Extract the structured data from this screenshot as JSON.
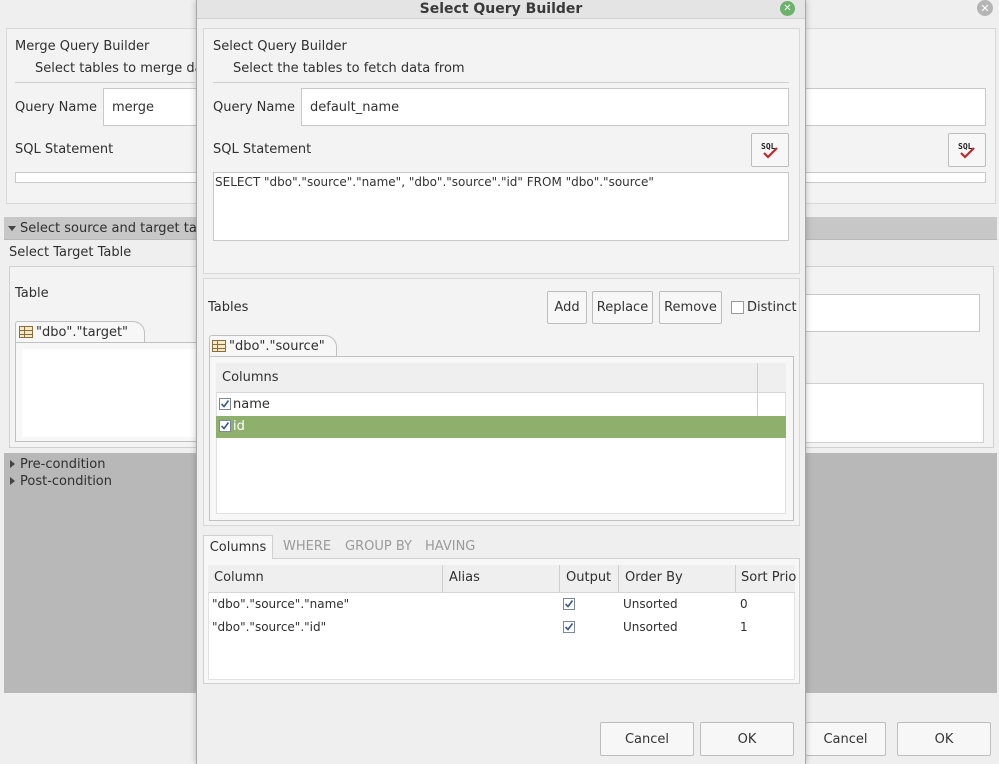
{
  "background": {
    "header_title": "Merge Query Builder",
    "header_subtitle": "Select tables to merge data",
    "query_name_label": "Query Name",
    "query_name_value": "merge",
    "sql_label": "SQL Statement",
    "section_title": "Select source and target tables",
    "target_title": "Select Target Table",
    "table_label": "Table",
    "target_tab": "\"dbo\".\"target\"",
    "precondition": "Pre-condition",
    "postcondition": "Post-condition",
    "cancel": "Cancel",
    "ok": "OK"
  },
  "dialog": {
    "title": "Select Query Builder",
    "header_title": "Select Query Builder",
    "header_subtitle": "Select the tables to fetch data from",
    "query_name_label": "Query Name",
    "query_name_value": "default_name",
    "sql_label": "SQL Statement",
    "sql_value": "SELECT \"dbo\".\"source\".\"name\", \"dbo\".\"source\".\"id\" FROM \"dbo\".\"source\"",
    "tables_label": "Tables",
    "add": "Add",
    "replace": "Replace",
    "remove": "Remove",
    "distinct": "Distinct",
    "source_tab": "\"dbo\".\"source\"",
    "columns_header": "Columns",
    "columns": [
      {
        "name": "name",
        "checked": true
      },
      {
        "name": "id",
        "checked": true
      }
    ],
    "bottom_tabs": [
      "Columns",
      "WHERE",
      "GROUP BY",
      "HAVING"
    ],
    "grid_headers": [
      "Column",
      "Alias",
      "Output",
      "Order By",
      "Sort Prio"
    ],
    "grid_rows": [
      {
        "column": "\"dbo\".\"source\".\"name\"",
        "alias": "",
        "output": true,
        "order_by": "Unsorted",
        "sort_prio": "0"
      },
      {
        "column": "\"dbo\".\"source\".\"id\"",
        "alias": "",
        "output": true,
        "order_by": "Unsorted",
        "sort_prio": "1"
      }
    ],
    "cancel": "Cancel",
    "ok": "OK"
  },
  "colors": {
    "selected_row": "#8fb06c",
    "gray_panel": "#b8b8b8",
    "close_icon_bg": "#6bb36b"
  }
}
